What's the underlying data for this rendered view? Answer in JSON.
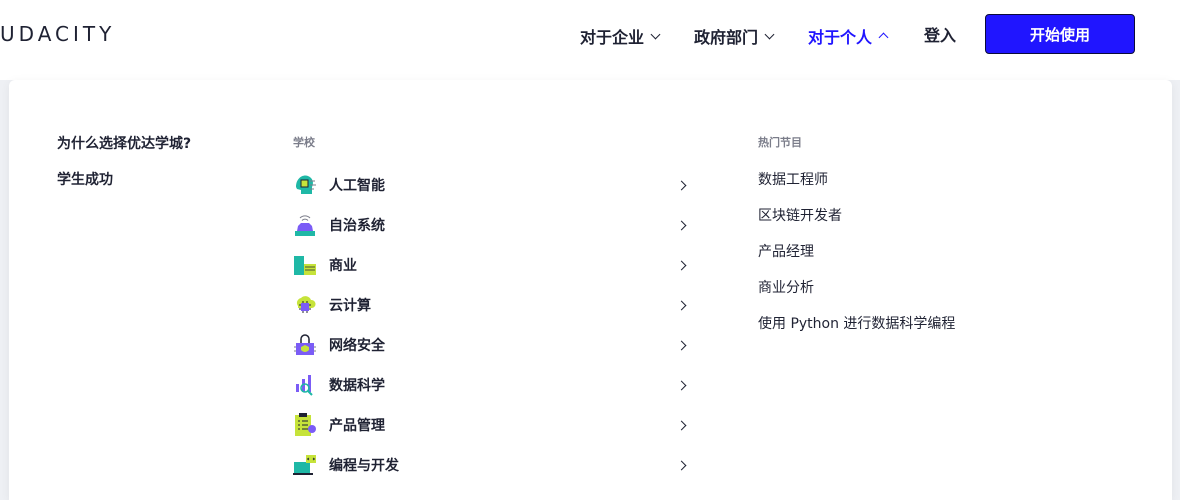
{
  "header": {
    "logo": "UDACITY",
    "nav": [
      {
        "label": "对于企业",
        "expanded": false
      },
      {
        "label": "政府部门",
        "expanded": false
      },
      {
        "label": "对于个人",
        "expanded": true
      }
    ],
    "login_label": "登入",
    "cta_label": "开始使用"
  },
  "menu": {
    "left_links": [
      "为什么选择优达学城?",
      "学生成功"
    ],
    "schools_title": "学校",
    "schools": [
      {
        "label": "人工智能",
        "icon": "ai-head-icon"
      },
      {
        "label": "自治系统",
        "icon": "autonomous-car-icon"
      },
      {
        "label": "商业",
        "icon": "business-building-icon"
      },
      {
        "label": "云计算",
        "icon": "cloud-chip-icon"
      },
      {
        "label": "网络安全",
        "icon": "lock-shield-icon"
      },
      {
        "label": "数据科学",
        "icon": "data-chart-icon"
      },
      {
        "label": "产品管理",
        "icon": "clipboard-checklist-icon"
      },
      {
        "label": "编程与开发",
        "icon": "code-laptop-icon"
      }
    ],
    "programs_title": "热门节目",
    "programs": [
      "数据工程师",
      "区块链开发者",
      "产品经理",
      "商业分析",
      "使用 Python 进行数据科学编程"
    ]
  },
  "colors": {
    "accent": "#2015ff",
    "text": "#1f2233",
    "icon_teal": "#1fb8a6",
    "icon_lime": "#c6e33a",
    "icon_purple": "#7b5cf6"
  }
}
